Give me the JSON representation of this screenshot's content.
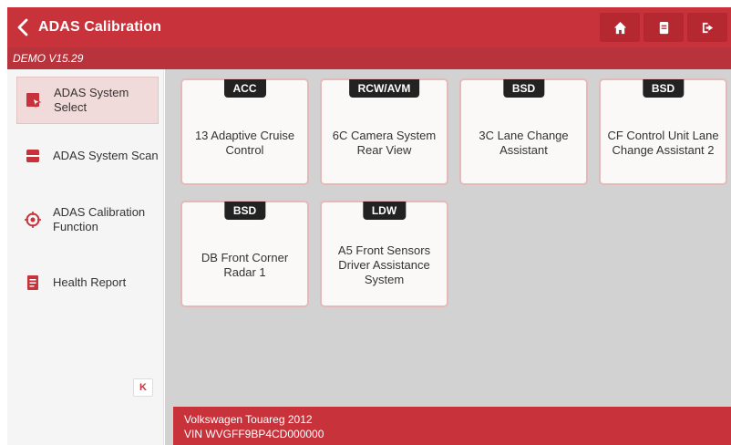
{
  "header": {
    "title": "ADAS Calibration",
    "subtitle": "DEMO V15.29",
    "home_icon": "home-icon",
    "report_icon": "report-icon",
    "exit_icon": "exit-icon"
  },
  "sidebar": {
    "items": [
      {
        "label": "ADAS System Select",
        "icon": "system-select-icon",
        "active": true
      },
      {
        "label": "ADAS System Scan",
        "icon": "system-scan-icon",
        "active": false
      },
      {
        "label": "ADAS Calibration Function",
        "icon": "calibration-target-icon",
        "active": false
      },
      {
        "label": "Health Report",
        "icon": "health-report-icon",
        "active": false
      }
    ],
    "collapse_label": "K"
  },
  "systems": [
    {
      "badge": "ACC",
      "label": "13 Adaptive Cruise Control"
    },
    {
      "badge": "RCW/AVM",
      "label": "6C Camera System Rear View"
    },
    {
      "badge": "BSD",
      "label": "3C Lane Change Assistant"
    },
    {
      "badge": "BSD",
      "label": "CF Control Unit Lane Change Assistant 2"
    },
    {
      "badge": "BSD",
      "label": "DB Front Corner Radar 1"
    },
    {
      "badge": "LDW",
      "label": "A5 Front Sensors Driver Assistance System"
    }
  ],
  "vehicle": {
    "model": "Volkswagen Touareg 2012",
    "vin": "VIN WVGFF9BP4CD000000"
  },
  "colors": {
    "accent": "#c8323a",
    "badge": "#222222",
    "background": "#d2d2d2"
  }
}
